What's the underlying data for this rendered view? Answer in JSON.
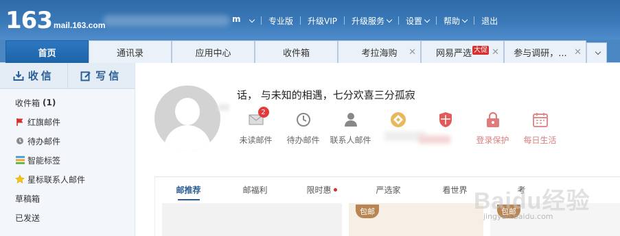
{
  "header": {
    "logo_number": "163",
    "logo_domain": "mail.163.com",
    "user_tail": "m",
    "nav": [
      {
        "label": "专业版",
        "has_caret": false
      },
      {
        "label": "升级VIP",
        "has_caret": false
      },
      {
        "label": "升级服务",
        "has_caret": true
      },
      {
        "label": "设置",
        "has_caret": true
      },
      {
        "label": "帮助",
        "has_caret": true
      },
      {
        "label": "退出",
        "has_caret": false
      }
    ]
  },
  "tabs": [
    {
      "label": "首页",
      "active": true,
      "closable": false
    },
    {
      "label": "通讯录",
      "active": false,
      "closable": false
    },
    {
      "label": "应用中心",
      "active": false,
      "closable": false
    },
    {
      "label": "收件箱",
      "active": false,
      "closable": false
    },
    {
      "label": "考拉海购",
      "active": false,
      "closable": true
    },
    {
      "label": "网易严选",
      "badge": "大促",
      "active": false,
      "closable": true
    },
    {
      "label": "参与调研，...",
      "active": false,
      "closable": true
    }
  ],
  "sidebar": {
    "receive_label": "收信",
    "compose_label": "写信",
    "folders": [
      {
        "label": "收件箱",
        "count": "(1)",
        "icon": "none"
      },
      {
        "label": "红旗邮件",
        "icon": "red-flag-icon"
      },
      {
        "label": "待办邮件",
        "icon": "clock-icon"
      },
      {
        "label": "智能标签",
        "icon": "tag-stack-icon"
      },
      {
        "label": "星标联系人邮件",
        "icon": "star-icon"
      },
      {
        "label": "草稿箱",
        "icon": "none"
      },
      {
        "label": "已发送",
        "icon": "none"
      }
    ]
  },
  "main": {
    "greeting": "话， 与未知的相遇，七分欢喜三分孤寂",
    "quick": [
      {
        "label": "未读邮件",
        "badge": "2",
        "icon": "mail-icon",
        "red": false
      },
      {
        "label": "待办邮件",
        "icon": "clock-icon",
        "red": false
      },
      {
        "label": "联系人邮件",
        "icon": "contact-icon",
        "red": false
      },
      {
        "label": "",
        "icon": "coin-icon",
        "red": false
      },
      {
        "label": "",
        "icon": "shield-icon",
        "red": false
      },
      {
        "label": "登录保护",
        "icon": "lock-icon",
        "red": true
      },
      {
        "label": "每日生活",
        "icon": "calendar-icon",
        "red": true
      }
    ],
    "subtabs": [
      {
        "label": "邮推荐",
        "active": true,
        "dot": false
      },
      {
        "label": "邮福利",
        "active": false,
        "dot": false
      },
      {
        "label": "限时惠",
        "active": false,
        "dot": true
      },
      {
        "label": "严选家",
        "active": false,
        "dot": false
      },
      {
        "label": "看世界",
        "active": false,
        "dot": false
      },
      {
        "label": "考",
        "active": false,
        "dot": false
      }
    ],
    "card_tags": [
      "",
      "包邮",
      "包邮"
    ]
  },
  "watermark": {
    "text": "Baidu经验",
    "sub": "jingyan.baidu.com"
  },
  "colors": {
    "header_top": "#2f6aa8",
    "accent": "#2b5e94",
    "active_tab": "#1d63a8",
    "badge_red": "#d72e2e"
  }
}
